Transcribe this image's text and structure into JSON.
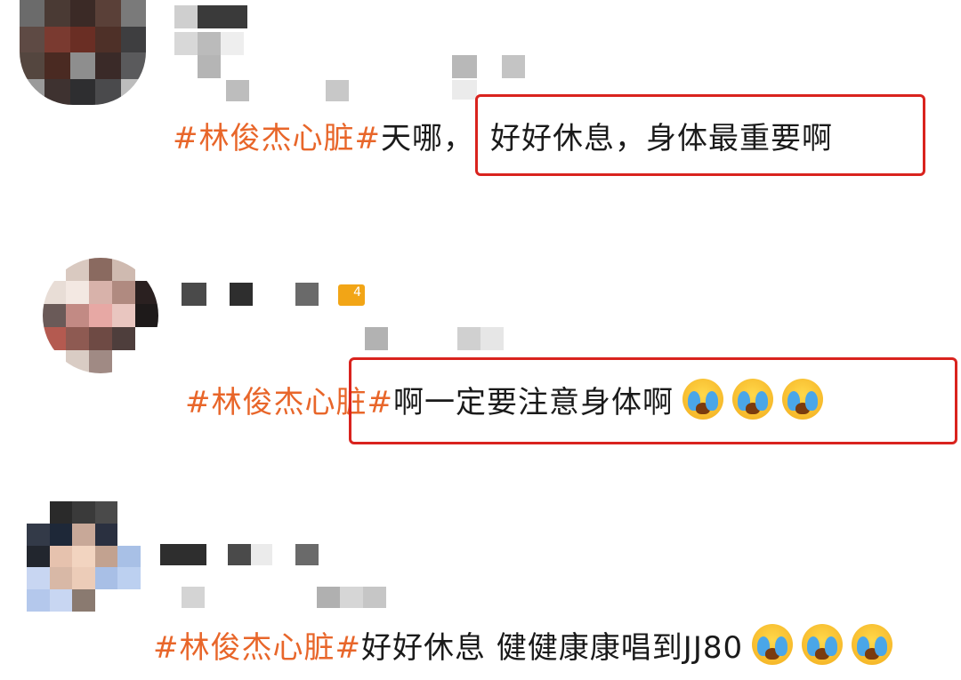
{
  "comments": [
    {
      "hashtag": "#林俊杰心脏#",
      "prefix": "天哪，",
      "highlight": "好好休息，身体最重要啊",
      "emoji_count": 0
    },
    {
      "hashtag": "#林俊杰心脏#",
      "prefix": "",
      "highlight": "啊一定要注意身体啊",
      "emoji": "crying-face-icon",
      "emoji_count": 3
    },
    {
      "hashtag": "#林俊杰心脏#",
      "prefix": "",
      "body": "好好休息 健健康康唱到JJ80",
      "emoji": "crying-face-icon",
      "emoji_count": 3
    }
  ],
  "colors": {
    "hashtag": "#e8662a",
    "highlight_border": "#d9231e",
    "text": "#1a1a1a"
  }
}
